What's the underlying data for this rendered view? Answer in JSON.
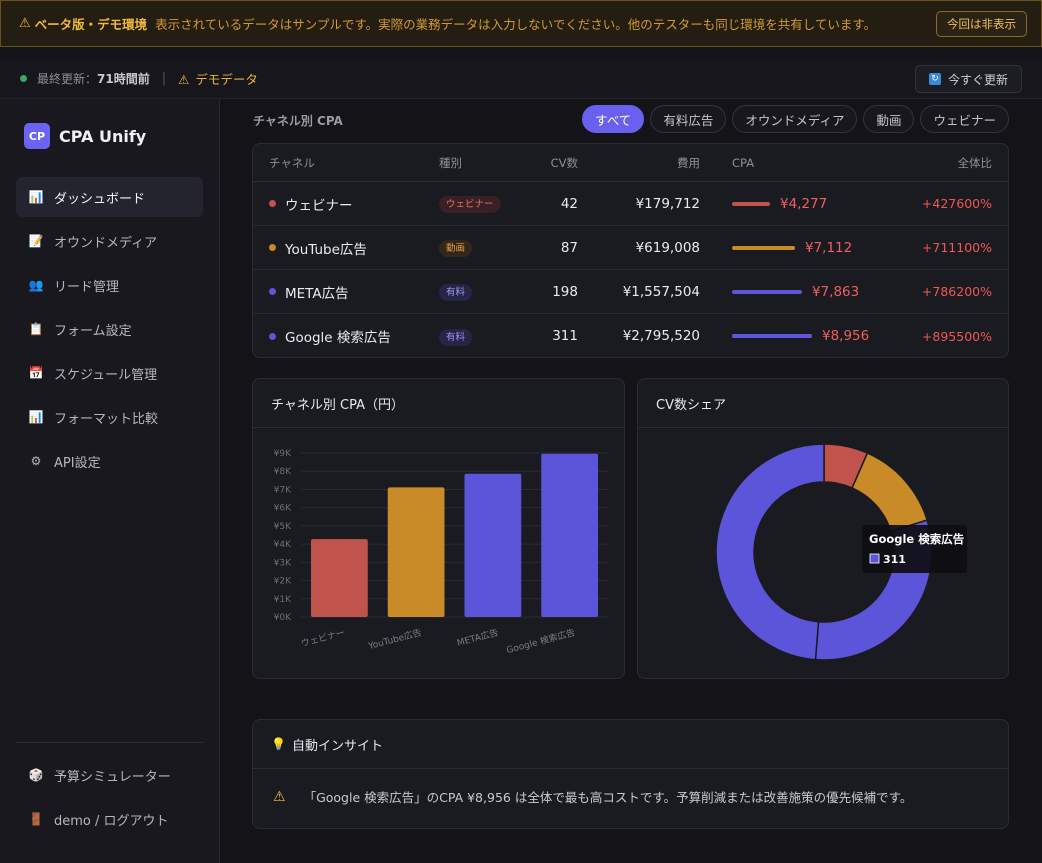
{
  "banner": {
    "title": "ベータ版・デモ環境",
    "message": "表示されているデータはサンプルです。実際の業務データは入力しないでください。他のテスターも同じ環境を共有しています。",
    "dismiss_label": "今回は非表示"
  },
  "status": {
    "last_updated_label": "最終更新：",
    "last_updated_value": "71時間前",
    "demo_label": "デモデータ",
    "refresh_label": "今すぐ更新"
  },
  "sidebar": {
    "logo": "CP",
    "app_name": "CPA Unify",
    "items": [
      {
        "label": "ダッシュボード",
        "icon": "bar-chart-icon",
        "active": true
      },
      {
        "label": "オウンドメディア",
        "icon": "memo-icon",
        "active": false
      },
      {
        "label": "リード管理",
        "icon": "people-icon",
        "active": false
      },
      {
        "label": "フォーム設定",
        "icon": "clipboard-icon",
        "active": false
      },
      {
        "label": "スケジュール管理",
        "icon": "calendar-icon",
        "active": false
      },
      {
        "label": "フォーマット比較",
        "icon": "bar-chart-icon",
        "active": false
      },
      {
        "label": "API設定",
        "icon": "gear-icon",
        "active": false
      }
    ],
    "bottom_items": [
      {
        "label": "予算シミュレーター",
        "icon": "dice-icon"
      },
      {
        "label": "demo / ログアウト",
        "icon": "door-icon"
      }
    ]
  },
  "main": {
    "section_title": "チャネル別 CPA",
    "filters": [
      "すべて",
      "有料広告",
      "オウンドメディア",
      "動画",
      "ウェビナー"
    ],
    "active_filter": "すべて",
    "table": {
      "headers": [
        "チャネル",
        "種別",
        "CV数",
        "費用",
        "CPA",
        "全体比"
      ],
      "rows": [
        {
          "name": "ウェビナー",
          "type": "ウェビナー",
          "cv": "42",
          "cost": "¥179,712",
          "cpa": "¥4,277",
          "pct": "+427600%",
          "color": "#c0544c",
          "badge_bg": "#3a1f24",
          "badge_fg": "#e07070",
          "cpa_value": 4277
        },
        {
          "name": "YouTube広告",
          "type": "動画",
          "cv": "87",
          "cost": "¥619,008",
          "cpa": "¥7,112",
          "pct": "+711100%",
          "color": "#c98a28",
          "badge_bg": "#33261a",
          "badge_fg": "#e0a040",
          "cpa_value": 7112
        },
        {
          "name": "META広告",
          "type": "有料",
          "cv": "198",
          "cost": "¥1,557,504",
          "cpa": "¥7,863",
          "pct": "+786200%",
          "color": "#5d55d9",
          "badge_bg": "#262545",
          "badge_fg": "#9b95f0",
          "cpa_value": 7863
        },
        {
          "name": "Google 検索広告",
          "type": "有料",
          "cv": "311",
          "cost": "¥2,795,520",
          "cpa": "¥8,956",
          "pct": "+895500%",
          "color": "#5d55d9",
          "badge_bg": "#262545",
          "badge_fg": "#9b95f0",
          "cpa_value": 8956
        }
      ]
    },
    "bar_chart_title": "チャネル別 CPA（円）",
    "donut_title": "CV数シェア",
    "tooltip": {
      "title": "Google 検索広告",
      "value": "311"
    },
    "insight": {
      "title": "自動インサイト",
      "message": "「Google 検索広告」のCPA ¥8,956 は全体で最も高コストです。予算削減または改善施策の優先候補です。"
    }
  },
  "chart_data": [
    {
      "type": "bar",
      "title": "チャネル別 CPA（円）",
      "categories": [
        "ウェビナー",
        "YouTube広告",
        "META広告",
        "Google 検索広告"
      ],
      "values": [
        4277,
        7112,
        7863,
        8956
      ],
      "colors": [
        "#c0544c",
        "#c98a28",
        "#5d55d9",
        "#5d55d9"
      ],
      "yticks": [
        "¥0K",
        "¥1K",
        "¥2K",
        "¥3K",
        "¥4K",
        "¥5K",
        "¥6K",
        "¥7K",
        "¥8K",
        "¥9K"
      ],
      "ylim": [
        0,
        9000
      ],
      "grid": true
    },
    {
      "type": "pie",
      "title": "CV数シェア",
      "categories": [
        "ウェビナー",
        "YouTube広告",
        "META広告",
        "Google 検索広告"
      ],
      "values": [
        42,
        87,
        198,
        311
      ],
      "colors": [
        "#c0544c",
        "#c98a28",
        "#5d55d9",
        "#5d55d9"
      ]
    }
  ]
}
